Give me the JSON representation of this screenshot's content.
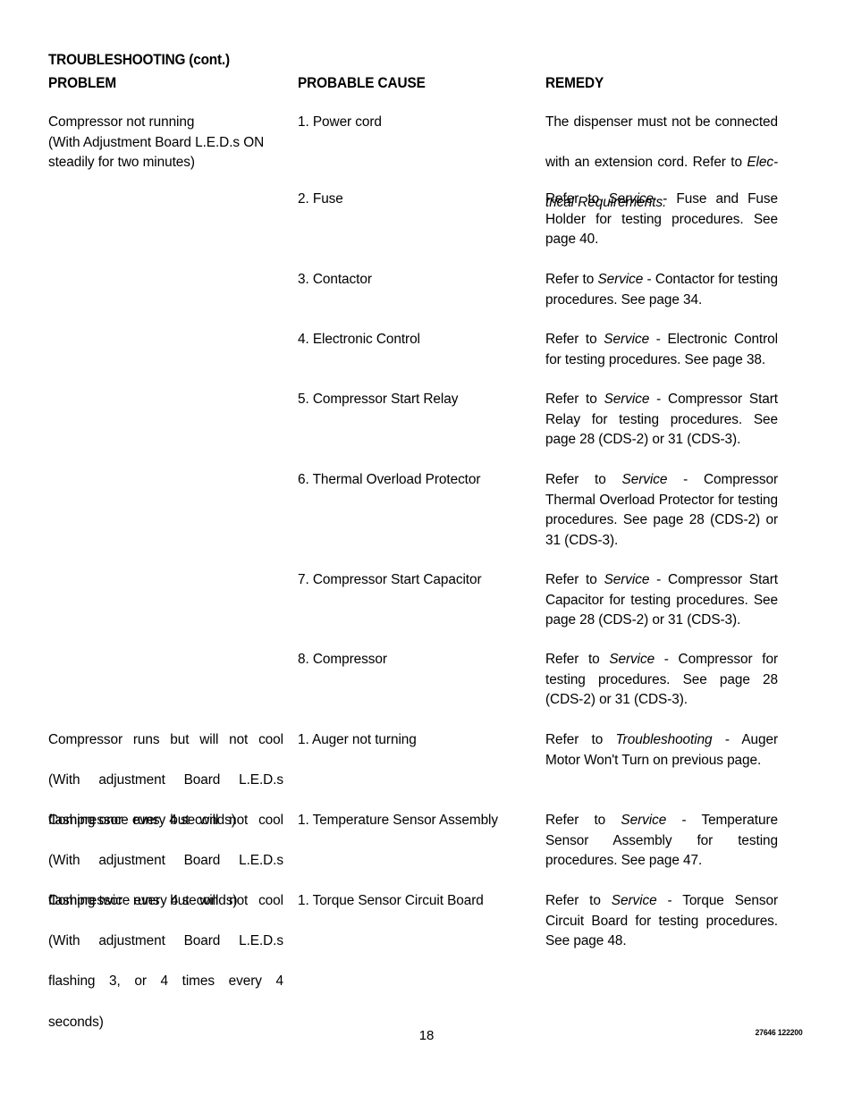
{
  "document": {
    "title": "TROUBLESHOOTING (cont.)",
    "page_number": "18",
    "doc_code": "27646 122200"
  },
  "columns": {
    "problem": "PROBLEM",
    "cause": "PROBABLE CAUSE",
    "remedy": "REMEDY"
  },
  "rows": [
    {
      "problem_lines": [
        "Compressor not running",
        "(With Adjustment Board L.E.D.s ON",
        "steadily for two minutes)"
      ],
      "cause": "1. Power cord",
      "remedy_lines": [
        "The dispenser must not be connected",
        "with an extension cord. Refer to ",
        "trical Requirements."
      ],
      "remedy_italic_1": "Elec-",
      "remedy_italic_2": "trical Requirements."
    },
    {
      "cause": "2. Fuse",
      "remedy_prefix": "Refer to ",
      "remedy_italic": "Service",
      "remedy_suffix": " - Fuse and Fuse Holder for testing procedures. See page 40."
    },
    {
      "cause": "3. Contactor",
      "remedy_prefix": "Refer to ",
      "remedy_italic": "Service",
      "remedy_suffix": " - Contactor for testing procedures. See page 34."
    },
    {
      "cause": "4. Electronic Control",
      "remedy_prefix": "Refer to ",
      "remedy_italic": "Service",
      "remedy_suffix": " - Electronic Control for testing procedures. See page 38."
    },
    {
      "cause": "5. Compressor Start Relay",
      "remedy_prefix": "Refer to ",
      "remedy_italic": "Service",
      "remedy_suffix": " - Compressor Start Relay for testing procedures. See page 28 (CDS-2) or 31 (CDS-3)."
    },
    {
      "cause": "6. Thermal Overload Protector",
      "remedy_prefix": "Refer to ",
      "remedy_italic": "Service",
      "remedy_suffix": " - Compressor Thermal Overload Protector for testing procedures. See page 28 (CDS-2) or 31 (CDS-3)."
    },
    {
      "cause": "7. Compressor Start Capacitor",
      "remedy_prefix": "Refer to ",
      "remedy_italic": "Service",
      "remedy_suffix": " - Compressor Start Capacitor for testing procedures. See page 28 (CDS-2) or 31 (CDS-3)."
    },
    {
      "cause": "8. Compressor",
      "remedy_prefix": "Refer to ",
      "remedy_italic": "Service",
      "remedy_suffix": " - Compressor for testing procedures. See page 28 (CDS-2) or 31 (CDS-3)."
    },
    {
      "problem_lines": [
        "Compressor runs but will not cool",
        "(With adjustment Board L.E.D.s",
        "flashing once every 4 seconds)"
      ],
      "cause": "1. Auger not turning",
      "remedy_prefix": "Refer to ",
      "remedy_italic": "Troubleshooting",
      "remedy_suffix": " - Auger Motor Won't Turn on previous page."
    },
    {
      "problem_lines": [
        "Compressor runs but will not cool",
        "(With adjustment Board L.E.D.s",
        "flashing twice every 4 seconds)"
      ],
      "cause": "1. Temperature Sensor Assembly",
      "remedy_prefix": "Refer to ",
      "remedy_italic": "Service",
      "remedy_suffix": " - Temperature Sensor Assembly for testing procedures. See page 47."
    },
    {
      "problem_lines": [
        "Compressor runs but will not cool",
        "(With adjustment Board L.E.D.s",
        "flashing 3, or 4 times every 4",
        "seconds)"
      ],
      "cause": "1. Torque Sensor Circuit Board",
      "remedy_prefix": "Refer to ",
      "remedy_italic": "Service",
      "remedy_suffix": " - Torque Sensor Circuit Board for testing procedures. See page 48."
    }
  ]
}
